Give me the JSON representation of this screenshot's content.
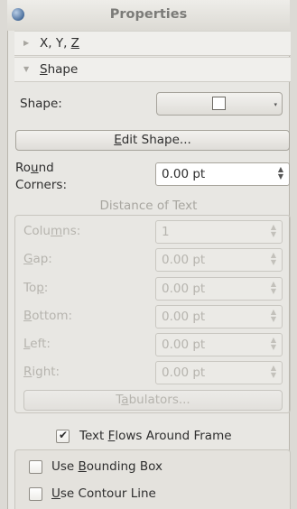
{
  "title": "Properties",
  "sections": {
    "xyz": {
      "label": "X, Y, Z",
      "expanded": false
    },
    "shape": {
      "label": "Shape",
      "expanded": true
    }
  },
  "shape": {
    "label": "Shape:",
    "edit_shape_label": "Edit Shape...",
    "round_corners_label_1": "Round",
    "round_corners_label_2": "Corners:",
    "round_corners_value": "0.00 pt"
  },
  "distance_of_text": {
    "title": "Distance of Text",
    "columns_label": "Columns:",
    "columns_value": "1",
    "gap_label": "Gap:",
    "gap_value": "0.00 pt",
    "top_label": "Top:",
    "top_value": "0.00 pt",
    "bottom_label": "Bottom:",
    "bottom_value": "0.00 pt",
    "left_label": "Left:",
    "left_value": "0.00 pt",
    "right_label": "Right:",
    "right_value": "0.00 pt",
    "tabulators_label": "Tabulators..."
  },
  "text_flow": {
    "label": "Text Flows Around Frame",
    "checked": true,
    "use_bounding_box_label": "Use Bounding Box",
    "use_bounding_box_checked": false,
    "use_contour_line_label": "Use Contour Line",
    "use_contour_line_checked": false
  }
}
